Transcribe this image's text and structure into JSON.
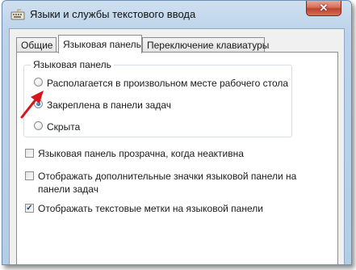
{
  "window": {
    "title": "Языки и службы текстового ввода",
    "close_glyph": "✕"
  },
  "tabs": [
    {
      "label": "Общие",
      "active": false
    },
    {
      "label": "Языковая панель",
      "active": true
    },
    {
      "label": "Переключение клавиатуры",
      "active": false
    }
  ],
  "language_bar": {
    "group_title": "Языковая панель",
    "options": [
      {
        "label": "Располагается в произвольном месте рабочего стола",
        "selected": false
      },
      {
        "label": "Закреплена в панели задач",
        "selected": true
      },
      {
        "label": "Скрыта",
        "selected": false
      }
    ]
  },
  "checkboxes": [
    {
      "label": "Языковая панель прозрачна, когда неактивна",
      "checked": false
    },
    {
      "label_line1": "Отображать дополнительные значки языковой панели на",
      "label_line2": "панели задач",
      "checked": false
    },
    {
      "label": "Отображать текстовые метки на языковой панели",
      "checked": true
    }
  ],
  "check_glyph": "✓",
  "colors": {
    "arrow": "#d8141c",
    "frame": "#b4cde6",
    "close_button": "#c0422c"
  }
}
